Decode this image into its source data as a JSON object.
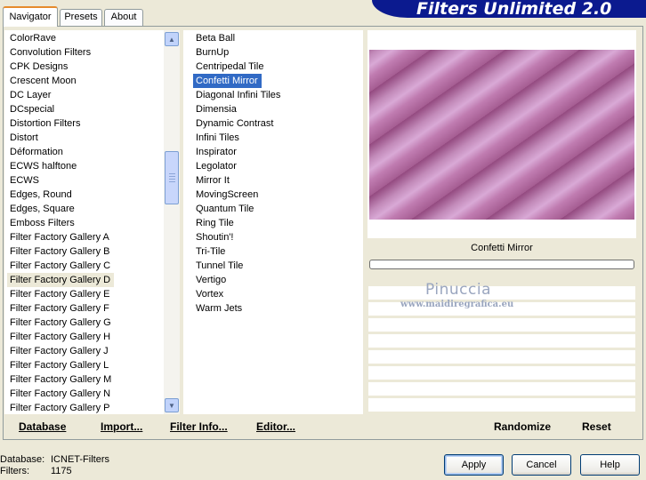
{
  "tabs": [
    {
      "label": "Navigator",
      "active": true
    },
    {
      "label": "Presets",
      "active": false
    },
    {
      "label": "About",
      "active": false
    }
  ],
  "banner_title": "Filters Unlimited 2.0",
  "categories": [
    "ColorRave",
    "Convolution Filters",
    "CPK Designs",
    "Crescent Moon",
    "DC Layer",
    "DCspecial",
    "Distortion Filters",
    "Distort",
    "Déformation",
    "ECWS halftone",
    "ECWS",
    "Edges, Round",
    "Edges, Square",
    "Emboss Filters",
    "Filter Factory Gallery A",
    "Filter Factory Gallery B",
    "Filter Factory Gallery C",
    "Filter Factory Gallery D",
    "Filter Factory Gallery E",
    "Filter Factory Gallery F",
    "Filter Factory Gallery G",
    "Filter Factory Gallery H",
    "Filter Factory Gallery J",
    "Filter Factory Gallery L",
    "Filter Factory Gallery M",
    "Filter Factory Gallery N",
    "Filter Factory Gallery P"
  ],
  "selected_category": "Filter Factory Gallery D",
  "filters": [
    "Beta Ball",
    "BurnUp",
    "Centripedal Tile",
    "Confetti Mirror",
    "Diagonal Infini Tiles",
    "Dimensia",
    "Dynamic Contrast",
    "Infini Tiles",
    "Inspirator",
    "Legolator",
    "Mirror It",
    "MovingScreen",
    "Quantum Tile",
    "Ring Tile",
    "Shoutin'!",
    "Tri-Tile",
    "Tunnel Tile",
    "Vertigo",
    "Vortex",
    "Warm Jets"
  ],
  "selected_filter": "Confetti Mirror",
  "list_buttons": {
    "database": "Database",
    "import": "Import...",
    "filter_info": "Filter Info...",
    "editor": "Editor..."
  },
  "preview": {
    "filter_name": "Confetti Mirror",
    "colors": [
      "#a55d92",
      "#c07cb1",
      "#d9a9d6",
      "#93497f"
    ]
  },
  "watermark": {
    "title": "Pinuccia",
    "url": "www.maidiregrafica.eu"
  },
  "preview_buttons": {
    "randomize": "Randomize",
    "reset": "Reset"
  },
  "status": {
    "database_label": "Database:",
    "database_value": "ICNET-Filters",
    "filters_label": "Filters:",
    "filters_value": "1175"
  },
  "dialog_buttons": {
    "apply": "Apply",
    "cancel": "Cancel",
    "help": "Help"
  }
}
